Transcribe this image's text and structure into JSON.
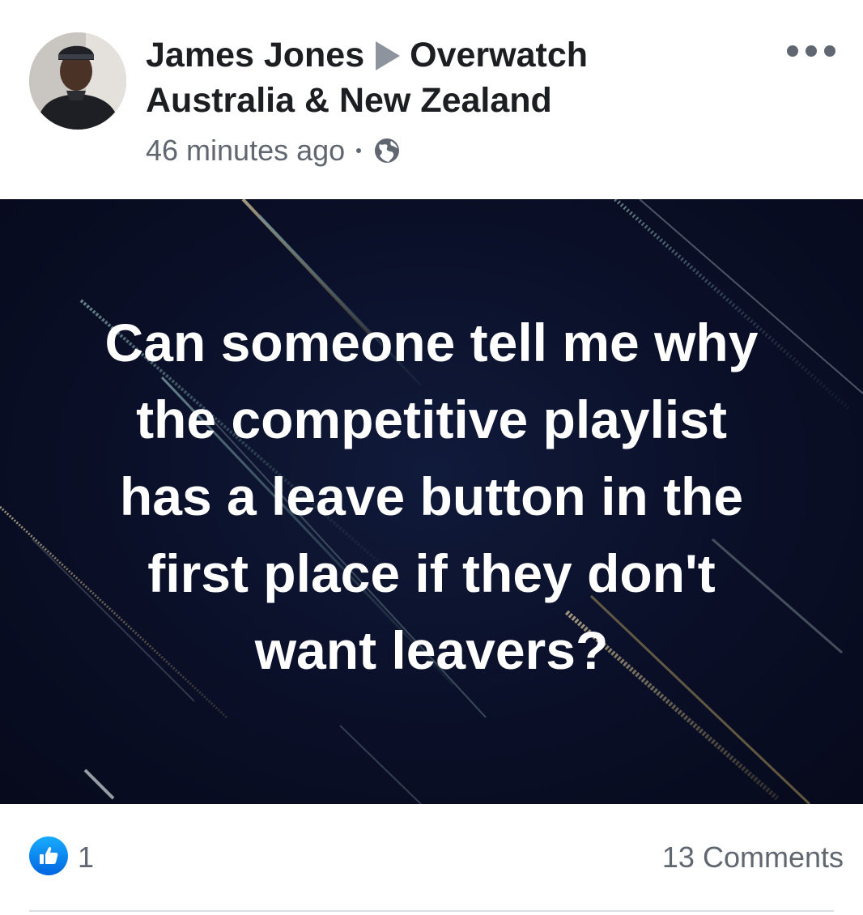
{
  "post": {
    "author": "James Jones",
    "group": "Overwatch Australia & New Zealand",
    "timestamp": "46 minutes ago",
    "privacy_icon": "globe-icon",
    "more_icon": "more-options-icon",
    "image_text": "Can someone tell me why\nthe competitive playlist\nhas a leave button in the\nfirst place if they don't\nwant leavers?"
  },
  "footer": {
    "like_icon": "like-icon",
    "like_count": "1",
    "comments": "13 Comments"
  },
  "colors": {
    "name_text": "#1c1e21",
    "meta_text": "#606770",
    "like_blue": "#1877f2",
    "image_background": "#0a0f27"
  }
}
